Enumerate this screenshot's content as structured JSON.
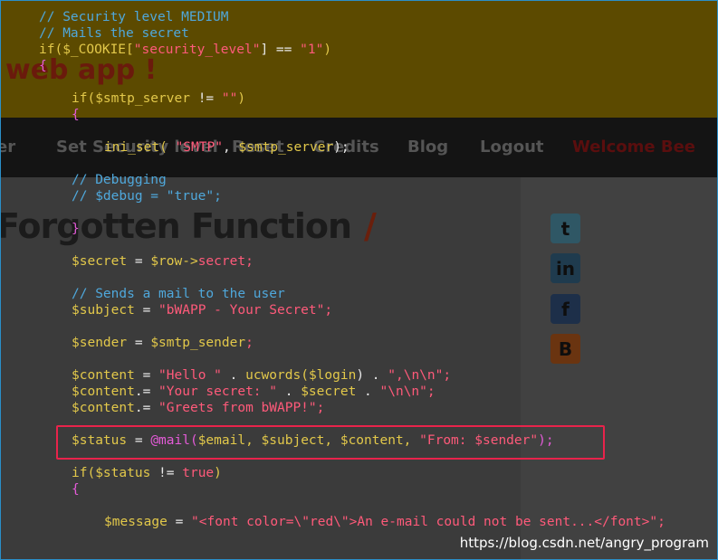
{
  "site": {
    "logo_text": "web app !",
    "nav": [
      "er",
      "Set Security level",
      "Reset",
      "Credits",
      "Blog",
      "Logout",
      "Welcome Bee"
    ],
    "page_title": "Forgotten Function",
    "title_slash": "/",
    "social_icons": [
      "twitter-icon",
      "linkedin-icon",
      "facebook-icon",
      "blogger-icon"
    ]
  },
  "code": {
    "line1_comment": "// Security level MEDIUM",
    "line2_comment": "// Mails the secret",
    "line3_kw": "if(",
    "line3_var": "$_COOKIE[",
    "line3_str": "\"security_level\"",
    "line3_mid": "] == ",
    "line3_str2": "\"1\"",
    "line3_end": ")",
    "line4": "{",
    "line5_kw": "if(",
    "line5_var": "$smtp_server",
    "line5_op": " != ",
    "line5_str": "\"\"",
    "line5_end": ")",
    "line6": "{",
    "line7_fn": "ini_set(",
    "line7_str": " \"SMTP\"",
    "line7_op": ", ",
    "line7_var": "$smtp_server",
    "line7_end": ");",
    "line8_comment": "// Debugging",
    "line9_comment": "// $debug = \"true\";",
    "line10": "}",
    "line11_var": "$secret",
    "line11_op": " = ",
    "line11_var2": "$row->",
    "line11_str": "secret;",
    "line12_comment": "// Sends a mail to the user",
    "line13_var": "$subject",
    "line13_op": " = ",
    "line13_str": "\"bWAPP - Your Secret\";",
    "line14_var": "$sender",
    "line14_op": " = ",
    "line14_var2": "$smtp_sender",
    "line14_end": ";",
    "line15_var": "$content",
    "line15_op": " = ",
    "line15_str": "\"Hello \"",
    "line15_op2": " . ",
    "line15_fn": "ucwords(",
    "line15_var2": "$login",
    "line15_end": ") . ",
    "line15_str2": "\",\\n\\n\";",
    "line16_var": "$content",
    "line16_op": ".= ",
    "line16_str": "\"Your secret: \"",
    "line16_op2": " . ",
    "line16_var2": "$secret",
    "line16_op3": " . ",
    "line16_str2": "\"\\n\\n\";",
    "line17_var": "$content",
    "line17_op": ".= ",
    "line17_str": "\"Greets from bWAPP!\";",
    "line18_var": "$status",
    "line18_op": " = ",
    "line18_at": "@mail(",
    "line18_args": "$email, $subject, $content, ",
    "line18_str": "\"From: $sender\"",
    "line18_end": ");",
    "line19_kw": "if(",
    "line19_var": "$status",
    "line19_op": " != ",
    "line19_str": "true",
    "line19_end": ")",
    "line20": "{",
    "line21_var": "$message",
    "line21_op": " = ",
    "line21_str": "\"<font color=\\\"red\\\">An e-mail could not be sent...</font>\";"
  },
  "watermark": "https://blog.csdn.net/angry_program",
  "colors": {
    "highlight_border": "#e8234b",
    "comment": "#4fa8dc",
    "string": "#ff5a7a",
    "variable": "#e2c84a"
  }
}
